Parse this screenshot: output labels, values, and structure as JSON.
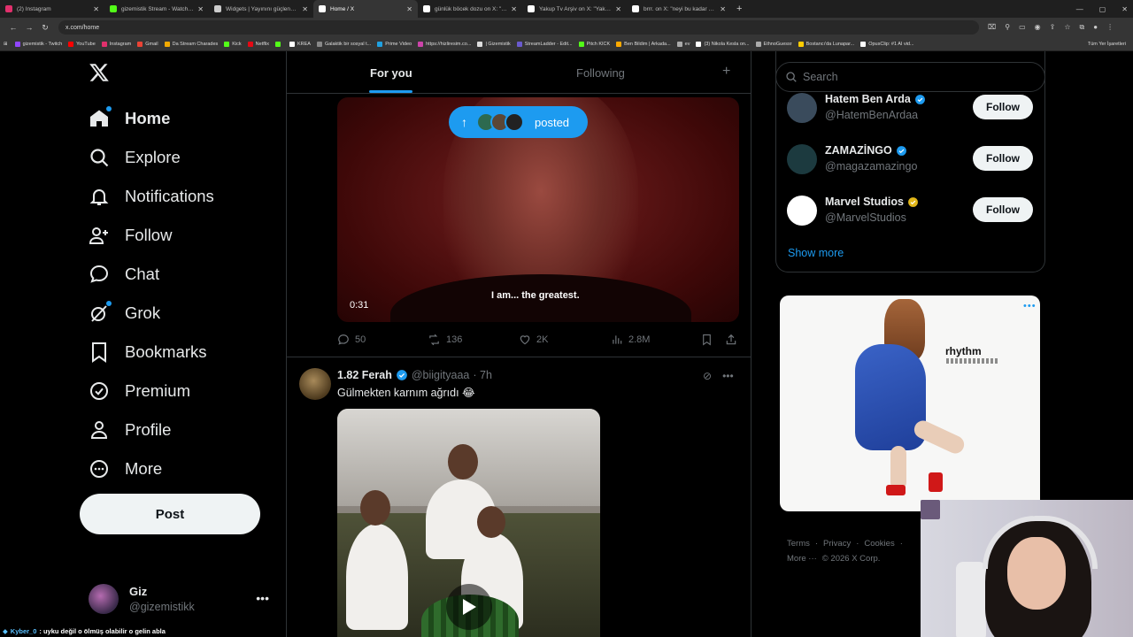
{
  "browser": {
    "tabs": [
      {
        "label": "(2) Instagram",
        "color": "#e1306c",
        "active": false
      },
      {
        "label": "gizemistik Stream - Watch Live",
        "color": "#53fc18",
        "active": false
      },
      {
        "label": "Widgets | Yayınını güçlendirme",
        "color": "#cccccc",
        "active": false
      },
      {
        "label": "Home / X",
        "color": "#ffffff",
        "active": true
      },
      {
        "label": "günlük böcek dozu on X: \"ingil",
        "color": "#ffffff",
        "active": false
      },
      {
        "label": "Yakup Tv Arşiv on X: \"Yakup Tv",
        "color": "#ffffff",
        "active": false
      },
      {
        "label": "brrr. on X: \"neyi bu kadar büyüt",
        "color": "#ffffff",
        "active": false
      }
    ],
    "url": "x.com/home",
    "bookmarks": [
      {
        "label": "gizemistik - Twitch",
        "color": "#9146ff"
      },
      {
        "label": "YouTube",
        "color": "#ff0000"
      },
      {
        "label": "Instagram",
        "color": "#e1306c"
      },
      {
        "label": "Gmail",
        "color": "#ea4335"
      },
      {
        "label": "Da Stream Charades",
        "color": "#f2a900"
      },
      {
        "label": "Kick",
        "color": "#53fc18"
      },
      {
        "label": "Netflix",
        "color": "#e50914"
      },
      {
        "label": "",
        "color": "#53fc18"
      },
      {
        "label": "KREA",
        "color": "#ffffff"
      },
      {
        "label": "Galaktik bir sosyal t...",
        "color": "#888888"
      },
      {
        "label": "Prime Video",
        "color": "#1fa0e0"
      },
      {
        "label": "https://hizliresim.co...",
        "color": "#cc44aa"
      },
      {
        "label": "| Gizemistik",
        "color": "#dddddd"
      },
      {
        "label": "StreamLadder - Edit...",
        "color": "#6a5acd"
      },
      {
        "label": "Pitch KICK",
        "color": "#53fc18"
      },
      {
        "label": "Ben Bildim | Arkada...",
        "color": "#ffaa00"
      },
      {
        "label": "ev",
        "color": "#aaaaaa"
      },
      {
        "label": "(3) Nikola Kesla on...",
        "color": "#ffffff"
      },
      {
        "label": "EthnoGuessr",
        "color": "#aaaaaa"
      },
      {
        "label": "Bostancı'da Lunapar...",
        "color": "#ffcc00"
      },
      {
        "label": "OpusClip: #1 AI vid...",
        "color": "#ffffff"
      }
    ],
    "all_bookmarks": "Tüm Yer İşaretleri"
  },
  "nav": {
    "items": [
      {
        "label": "Home",
        "icon": "home-icon",
        "active": true
      },
      {
        "label": "Explore",
        "icon": "search-icon",
        "active": false
      },
      {
        "label": "Notifications",
        "icon": "bell-icon",
        "active": false
      },
      {
        "label": "Follow",
        "icon": "add-user-icon",
        "active": false
      },
      {
        "label": "Chat",
        "icon": "chat-icon",
        "active": false
      },
      {
        "label": "Grok",
        "icon": "grok-icon",
        "active": false
      },
      {
        "label": "Bookmarks",
        "icon": "bookmark-icon",
        "active": false
      },
      {
        "label": "Premium",
        "icon": "premium-icon",
        "active": false
      },
      {
        "label": "Profile",
        "icon": "person-icon",
        "active": false
      },
      {
        "label": "More",
        "icon": "more-circle-icon",
        "active": false
      }
    ],
    "post_label": "Post",
    "account": {
      "name": "Giz",
      "handle": "@gizemistikk"
    }
  },
  "timeline": {
    "tabs": {
      "for_you": "For you",
      "following": "Following"
    },
    "posted_pill": "posted",
    "post1": {
      "video_time": "0:31",
      "caption": "I am... the greatest.",
      "replies": "50",
      "reposts": "136",
      "likes": "2K",
      "views": "2.8M"
    },
    "post2": {
      "name": "1.82 Ferah",
      "handle": "@biigityaaa",
      "time": "· 7h",
      "text": "Gülmekten karnım ağrıdı 😂"
    }
  },
  "sidebar": {
    "search_placeholder": "Search",
    "who_to_follow": [
      {
        "name": "Hatem Ben Arda",
        "handle": "@HatemBenArdaa",
        "follow": "Follow"
      },
      {
        "name": "ZAMAZİNGO",
        "handle": "@magazamazingo",
        "follow": "Follow"
      },
      {
        "name": "Marvel Studios",
        "handle": "@MarvelStudios",
        "follow": "Follow"
      }
    ],
    "show_more": "Show more",
    "ad_brand": "rhythm",
    "footer": [
      "Terms",
      "·",
      "Privacy",
      "·",
      "Cookies",
      "·"
    ],
    "footer2": [
      "More ···",
      "© 2026 X Corp."
    ]
  },
  "overlay": {
    "chat_name": "Kyber_0",
    "chat_message": ": uyku değil o ölmüş olabilir o gelin abla"
  },
  "colors": {
    "accent": "#1d9bf0",
    "background": "#000000",
    "border": "#2f3336",
    "muted": "#71767b"
  }
}
